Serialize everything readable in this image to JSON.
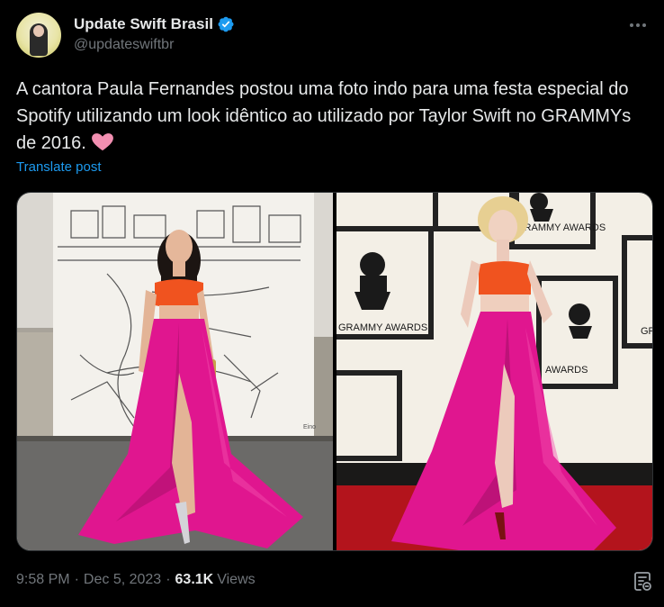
{
  "author": {
    "display_name": "Update Swift Brasil",
    "handle": "@updateswiftbr",
    "verified": true,
    "verified_color": "#1d9bf0"
  },
  "post": {
    "text": "A cantora Paula Fernandes postou uma foto indo para uma festa especial do Spotify utilizando um look idêntico ao utilizado por Taylor Swift no GRAMMYs de 2016.",
    "emoji": "pink-heart-icon",
    "translate_label": "Translate post",
    "time": "9:58 PM",
    "separator": "·",
    "date": "Dec 5, 2023",
    "views_count": "63.1K",
    "views_label": "Views"
  },
  "media": {
    "right_photo_texts": {
      "grammy_top": "GRAMMY AWARDS",
      "grammy_left": "GRAMMY AWARDS",
      "grammy_mid": "AWARDS",
      "grammy_edge": "GR"
    }
  },
  "colors": {
    "accent": "#1d9bf0",
    "skirt": "#e0168f",
    "top": "#f0531f",
    "heart": "#f28fb1"
  }
}
